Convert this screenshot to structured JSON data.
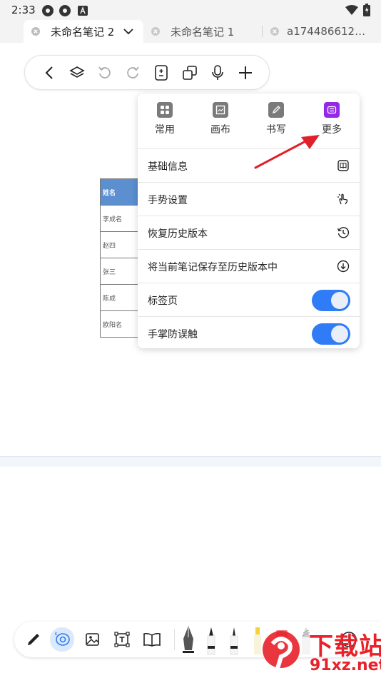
{
  "status_bar": {
    "time": "2:33"
  },
  "tabs": [
    {
      "label": "未命名笔记 2",
      "active": true
    },
    {
      "label": "未命名笔记 1",
      "active": false
    },
    {
      "label": "a174486612…",
      "active": false
    }
  ],
  "toolbar": {
    "icons": [
      "back-icon",
      "layers-icon",
      "undo-icon",
      "redo-icon",
      "page-icon",
      "copy-icon",
      "mic-icon",
      "plus-icon"
    ]
  },
  "doc_table": {
    "header": "姓名",
    "rows": [
      "李成名",
      "赵四",
      "张三",
      "陈成",
      "欧阳名"
    ]
  },
  "menu": {
    "tabs": [
      {
        "label": "常用",
        "icon": "grid-icon"
      },
      {
        "label": "画布",
        "icon": "canvas-icon"
      },
      {
        "label": "书写",
        "icon": "pen-icon"
      },
      {
        "label": "更多",
        "icon": "more-settings-icon",
        "active": true
      }
    ],
    "items": [
      {
        "label": "基础信息",
        "icon": "info-book-icon"
      },
      {
        "label": "手势设置",
        "icon": "gesture-icon"
      },
      {
        "label": "恢复历史版本",
        "icon": "history-icon"
      },
      {
        "label": "将当前笔记保存至历史版本中",
        "icon": "save-down-icon"
      },
      {
        "label": "标签页",
        "toggle": true
      },
      {
        "label": "手掌防误触",
        "toggle": true
      }
    ]
  },
  "colors": {
    "accent": "#2f7cf6",
    "active_tab_icon": "#9328e6",
    "annotation_arrow": "#e0202a"
  },
  "watermark": {
    "main": "下载站",
    "sub": "91xz.net"
  }
}
